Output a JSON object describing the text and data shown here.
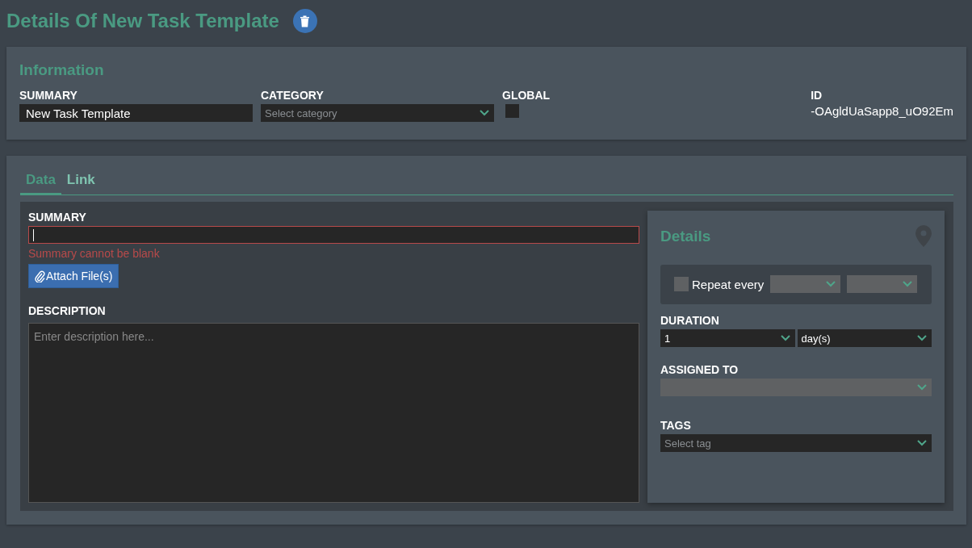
{
  "page": {
    "title": "Details Of New Task Template"
  },
  "information": {
    "title": "Information",
    "summary": {
      "label": "SUMMARY",
      "value": "New Task Template"
    },
    "category": {
      "label": "CATEGORY",
      "placeholder": "Select category"
    },
    "global": {
      "label": "GLOBAL",
      "checked": false
    },
    "id": {
      "label": "ID",
      "value": "-OAgldUaSapp8_uO92Em"
    }
  },
  "tabs": [
    {
      "label": "Data",
      "selected": true
    },
    {
      "label": "Link",
      "selected": false
    }
  ],
  "data": {
    "summary": {
      "label": "SUMMARY",
      "error": "Summary cannot be blank"
    },
    "attach_button": "Attach File(s)",
    "description": {
      "label": "DESCRIPTION",
      "placeholder": "Enter description here..."
    }
  },
  "details": {
    "title": "Details",
    "repeat": {
      "label": "Repeat every",
      "checked": false
    },
    "duration": {
      "label": "DURATION",
      "value": "1",
      "unit": "day(s)"
    },
    "assigned_to": {
      "label": "ASSIGNED TO",
      "disabled": true
    },
    "tags": {
      "label": "TAGS",
      "placeholder": "Select tag"
    }
  }
}
